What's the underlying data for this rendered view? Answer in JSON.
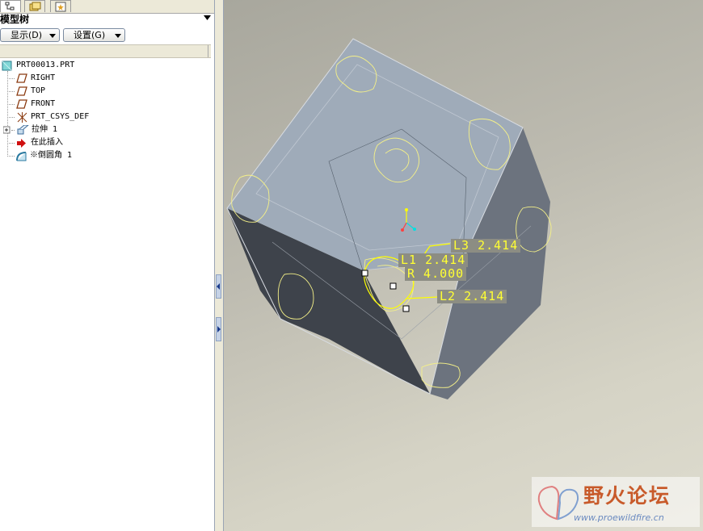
{
  "left_panel": {
    "tabs": [
      {
        "icon": "model-tree-tab-icon"
      },
      {
        "icon": "folder-browser-tab-icon"
      },
      {
        "icon": "favorites-tab-icon"
      }
    ],
    "title": "模型树",
    "buttons": {
      "display_label": "显示(D)",
      "settings_label": "设置(G)"
    },
    "tree": [
      {
        "label": "PRT00013.PRT",
        "icon": "part-icon"
      },
      {
        "label": "RIGHT",
        "icon": "datum-plane-icon"
      },
      {
        "label": "TOP",
        "icon": "datum-plane-icon"
      },
      {
        "label": "FRONT",
        "icon": "datum-plane-icon"
      },
      {
        "label": "PRT_CSYS_DEF",
        "icon": "coordinate-system-icon"
      },
      {
        "label": "拉伸 1",
        "icon": "extrude-icon"
      },
      {
        "label": "在此插入",
        "icon": "insert-here-arrow-icon"
      },
      {
        "label": "※倒圆角 1",
        "icon": "round-icon"
      }
    ]
  },
  "viewport": {
    "dimensions": [
      {
        "label": "L3 2.414"
      },
      {
        "label": "L1 2.414"
      },
      {
        "label": "R 4.000"
      },
      {
        "label": "L2 2.414"
      }
    ],
    "watermark": {
      "text": "野火论坛",
      "url": "www.proewildfire.cn"
    },
    "colors": {
      "top_face": "#9fabb9",
      "right_face": "#6c737e",
      "left_face": "#3e434b",
      "dimension_text": "#ffff33",
      "round_edges": "#f4f088"
    }
  }
}
